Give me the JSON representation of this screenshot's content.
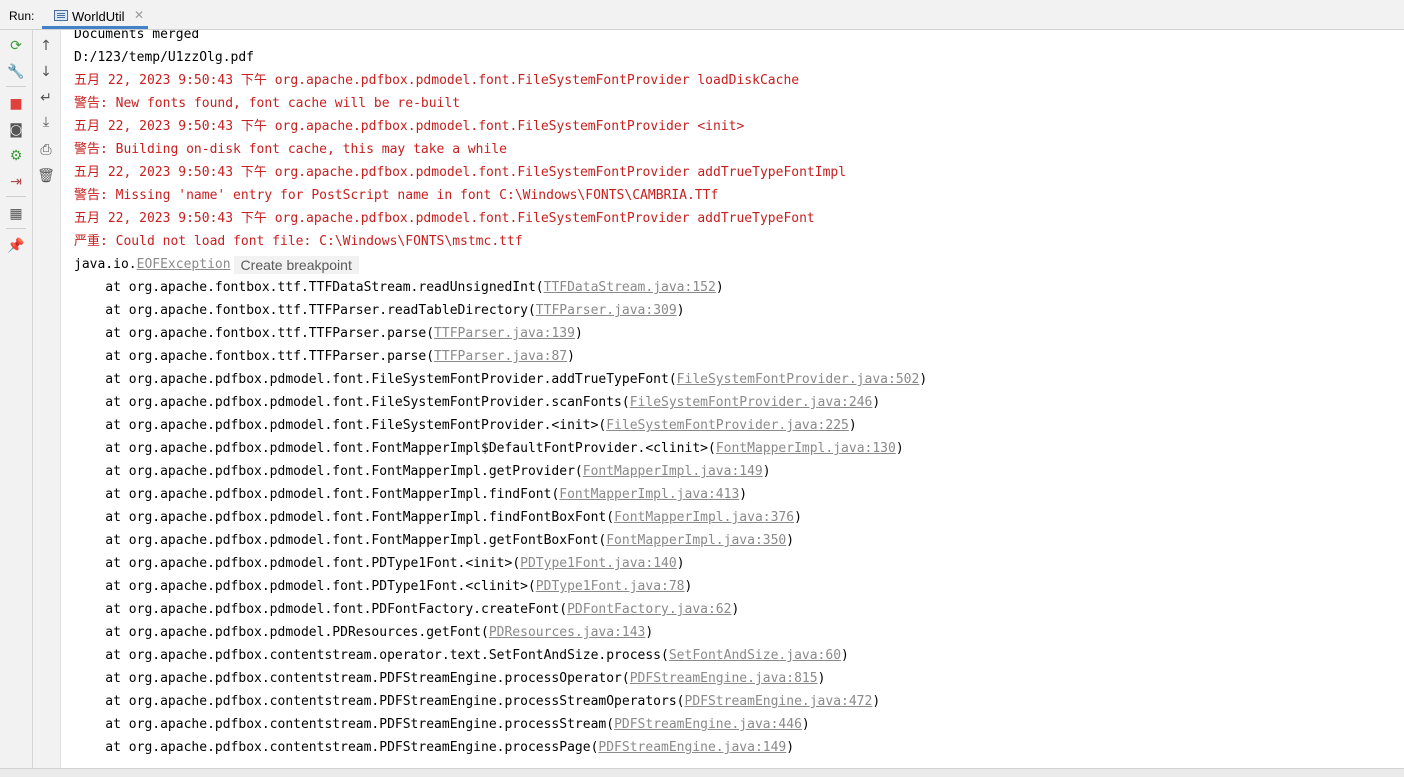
{
  "run_bar": {
    "label": "Run:",
    "tab_label": "WorldUtil"
  },
  "toolbar_left": [
    {
      "name": "rerun-icon",
      "glyph": "⟳"
    },
    {
      "name": "wrench-icon",
      "glyph": "🔧"
    },
    {
      "name": "stop-icon",
      "glyph": "■"
    },
    {
      "name": "camera-icon",
      "glyph": "◙"
    },
    {
      "name": "settings-gear-icon",
      "glyph": "⚙"
    },
    {
      "name": "login-icon",
      "glyph": "⇥"
    },
    {
      "name": "layout-icon",
      "glyph": "▦"
    },
    {
      "name": "pin-icon",
      "glyph": "📌"
    }
  ],
  "toolbar_right": [
    {
      "name": "up-arrow-icon",
      "glyph": "↑"
    },
    {
      "name": "down-arrow-icon",
      "glyph": "↓"
    },
    {
      "name": "soft-wrap-icon",
      "glyph": "↵"
    },
    {
      "name": "scroll-to-end-icon",
      "glyph": "⤓"
    },
    {
      "name": "print-icon",
      "glyph": "⎙"
    },
    {
      "name": "trash-icon",
      "glyph": "🗑"
    }
  ],
  "console": {
    "plain_lines": [
      {
        "text": "Documents merged",
        "color": "black"
      },
      {
        "text": "D:/123/temp/U1zzOlg.pdf",
        "color": "black"
      },
      {
        "text": "五月 22, 2023 9:50:43 下午 org.apache.pdfbox.pdmodel.font.FileSystemFontProvider loadDiskCache",
        "color": "red"
      },
      {
        "text": "警告: New fonts found, font cache will be re-built",
        "color": "red"
      },
      {
        "text": "五月 22, 2023 9:50:43 下午 org.apache.pdfbox.pdmodel.font.FileSystemFontProvider <init>",
        "color": "red"
      },
      {
        "text": "警告: Building on-disk font cache, this may take a while",
        "color": "red"
      },
      {
        "text": "五月 22, 2023 9:50:43 下午 org.apache.pdfbox.pdmodel.font.FileSystemFontProvider addTrueTypeFontImpl",
        "color": "red"
      },
      {
        "text": "警告: Missing 'name' entry for PostScript name in font C:\\Windows\\FONTS\\CAMBRIA.TTf",
        "color": "red"
      },
      {
        "text": "五月 22, 2023 9:50:43 下午 org.apache.pdfbox.pdmodel.font.FileSystemFontProvider addTrueTypeFont",
        "color": "red"
      },
      {
        "text": "严重: Could not load font file: C:\\Windows\\FONTS\\mstmc.ttf",
        "color": "red"
      }
    ],
    "exception": {
      "prefix": "java.io.",
      "link": "EOFException",
      "tooltip": "Create breakpoint"
    },
    "stack": [
      {
        "method": "org.apache.fontbox.ttf.TTFDataStream.readUnsignedInt",
        "link": "TTFDataStream.java:152"
      },
      {
        "method": "org.apache.fontbox.ttf.TTFParser.readTableDirectory",
        "link": "TTFParser.java:309"
      },
      {
        "method": "org.apache.fontbox.ttf.TTFParser.parse",
        "link": "TTFParser.java:139"
      },
      {
        "method": "org.apache.fontbox.ttf.TTFParser.parse",
        "link": "TTFParser.java:87"
      },
      {
        "method": "org.apache.pdfbox.pdmodel.font.FileSystemFontProvider.addTrueTypeFont",
        "link": "FileSystemFontProvider.java:502"
      },
      {
        "method": "org.apache.pdfbox.pdmodel.font.FileSystemFontProvider.scanFonts",
        "link": "FileSystemFontProvider.java:246"
      },
      {
        "method": "org.apache.pdfbox.pdmodel.font.FileSystemFontProvider.<init>",
        "link": "FileSystemFontProvider.java:225"
      },
      {
        "method": "org.apache.pdfbox.pdmodel.font.FontMapperImpl$DefaultFontProvider.<clinit>",
        "link": "FontMapperImpl.java:130"
      },
      {
        "method": "org.apache.pdfbox.pdmodel.font.FontMapperImpl.getProvider",
        "link": "FontMapperImpl.java:149"
      },
      {
        "method": "org.apache.pdfbox.pdmodel.font.FontMapperImpl.findFont",
        "link": "FontMapperImpl.java:413"
      },
      {
        "method": "org.apache.pdfbox.pdmodel.font.FontMapperImpl.findFontBoxFont",
        "link": "FontMapperImpl.java:376"
      },
      {
        "method": "org.apache.pdfbox.pdmodel.font.FontMapperImpl.getFontBoxFont",
        "link": "FontMapperImpl.java:350"
      },
      {
        "method": "org.apache.pdfbox.pdmodel.font.PDType1Font.<init>",
        "link": "PDType1Font.java:140"
      },
      {
        "method": "org.apache.pdfbox.pdmodel.font.PDType1Font.<clinit>",
        "link": "PDType1Font.java:78"
      },
      {
        "method": "org.apache.pdfbox.pdmodel.font.PDFontFactory.createFont",
        "link": "PDFontFactory.java:62"
      },
      {
        "method": "org.apache.pdfbox.pdmodel.PDResources.getFont",
        "link": "PDResources.java:143"
      },
      {
        "method": "org.apache.pdfbox.contentstream.operator.text.SetFontAndSize.process",
        "link": "SetFontAndSize.java:60"
      },
      {
        "method": "org.apache.pdfbox.contentstream.PDFStreamEngine.processOperator",
        "link": "PDFStreamEngine.java:815"
      },
      {
        "method": "org.apache.pdfbox.contentstream.PDFStreamEngine.processStreamOperators",
        "link": "PDFStreamEngine.java:472"
      },
      {
        "method": "org.apache.pdfbox.contentstream.PDFStreamEngine.processStream",
        "link": "PDFStreamEngine.java:446"
      },
      {
        "method": "org.apache.pdfbox.contentstream.PDFStreamEngine.processPage",
        "link": "PDFStreamEngine.java:149"
      }
    ]
  },
  "colors": {
    "error_text": "#c71f1f",
    "link_text": "#8a8a8a",
    "tab_underline": "#4083c9",
    "stop_red": "#e0413b",
    "rerun_green": "#3c9a3c"
  }
}
